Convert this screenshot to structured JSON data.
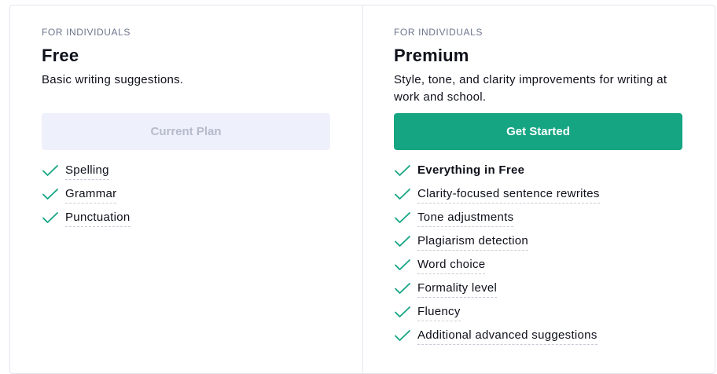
{
  "free": {
    "eyebrow": "FOR INDIVIDUALS",
    "name": "Free",
    "description": "Basic writing suggestions.",
    "button_label": "Current Plan",
    "features": [
      "Spelling",
      "Grammar",
      "Punctuation"
    ]
  },
  "premium": {
    "eyebrow": "FOR INDIVIDUALS",
    "name": "Premium",
    "description": "Style, tone, and clarity improvements for writing at work and school.",
    "button_label": "Get Started",
    "features": [
      "Everything in Free",
      "Clarity-focused sentence rewrites",
      "Tone adjustments",
      "Plagiarism detection",
      "Word choice",
      "Formality level",
      "Fluency",
      "Additional advanced suggestions"
    ]
  },
  "colors": {
    "accent": "#15a582",
    "check": "#15a582",
    "disabled_button_bg": "#eef0fb",
    "disabled_button_text": "#b6bbcb"
  },
  "icons": {
    "feature": "check-icon"
  }
}
